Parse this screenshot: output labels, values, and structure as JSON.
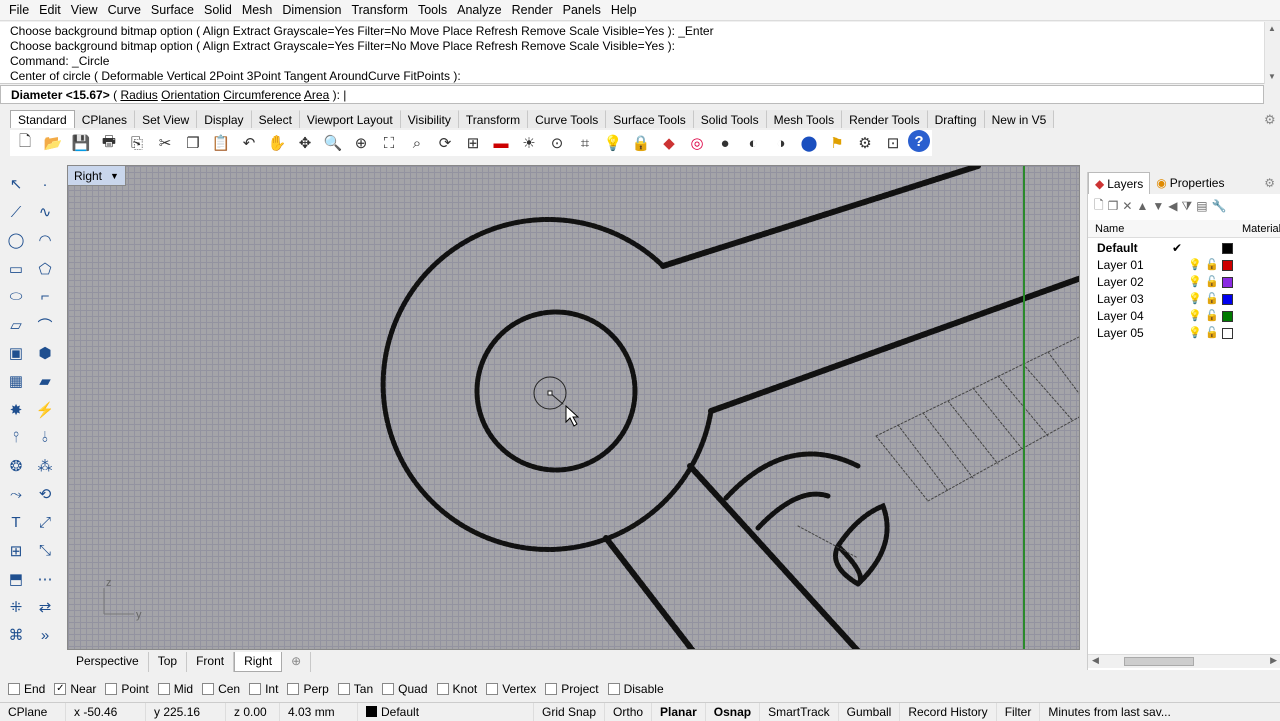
{
  "menu": [
    "File",
    "Edit",
    "View",
    "Curve",
    "Surface",
    "Solid",
    "Mesh",
    "Dimension",
    "Transform",
    "Tools",
    "Analyze",
    "Render",
    "Panels",
    "Help"
  ],
  "command_history": [
    "Choose background bitmap option ( Align  Extract  Grayscale=Yes  Filter=No  Move  Place  Refresh  Remove  Scale  Visible=Yes ): _Enter",
    "Choose background bitmap option ( Align  Extract  Grayscale=Yes  Filter=No  Move  Place  Refresh  Remove  Scale  Visible=Yes ):",
    "Command: _Circle",
    "Center of circle ( Deformable  Vertical  2Point  3Point  Tangent  AroundCurve  FitPoints ):"
  ],
  "command_prompt": {
    "label": "Diameter <15.67>",
    "options": [
      "Radius",
      "Orientation",
      "Circumference",
      "Area"
    ]
  },
  "toolbar_tabs": [
    "Standard",
    "CPlanes",
    "Set View",
    "Display",
    "Select",
    "Viewport Layout",
    "Visibility",
    "Transform",
    "Curve Tools",
    "Surface Tools",
    "Solid Tools",
    "Mesh Tools",
    "Render Tools",
    "Drafting",
    "New in V5"
  ],
  "toolbar_icons": [
    "new-icon",
    "open-icon",
    "save-icon",
    "print-icon",
    "import-icon",
    "cut-icon",
    "copy-icon",
    "paste-icon",
    "undo-icon",
    "pan-icon",
    "move-view-icon",
    "zoom-icon",
    "zoom-window-icon",
    "zoom-extents-icon",
    "zoom-selected-icon",
    "rotate-view-icon",
    "four-viewports-icon",
    "car-icon",
    "sun-icon",
    "point-osnap-icon",
    "grid-icon",
    "light-icon",
    "lock-icon",
    "layer-icon",
    "color-wheel-icon",
    "shade-icon",
    "sphere-icon",
    "render-sphere-icon",
    "material-icon",
    "flag-icon",
    "settings-icon",
    "options-icon",
    "help-icon"
  ],
  "viewport": {
    "title": "Right",
    "axis_z": "z",
    "axis_y": "y"
  },
  "viewport_tabs": [
    "Perspective",
    "Top",
    "Front",
    "Right"
  ],
  "osnap": [
    {
      "label": "End",
      "checked": false
    },
    {
      "label": "Near",
      "checked": true
    },
    {
      "label": "Point",
      "checked": false
    },
    {
      "label": "Mid",
      "checked": false
    },
    {
      "label": "Cen",
      "checked": false
    },
    {
      "label": "Int",
      "checked": false
    },
    {
      "label": "Perp",
      "checked": false
    },
    {
      "label": "Tan",
      "checked": false
    },
    {
      "label": "Quad",
      "checked": false
    },
    {
      "label": "Knot",
      "checked": false
    },
    {
      "label": "Vertex",
      "checked": false
    },
    {
      "label": "Project",
      "checked": false
    },
    {
      "label": "Disable",
      "checked": false
    }
  ],
  "status": {
    "cplane": "CPlane",
    "x": "x -50.46",
    "y": "y 225.16",
    "z": "z 0.00",
    "dist": "4.03 mm",
    "layer": "Default",
    "grid_snap": "Grid Snap",
    "ortho": "Ortho",
    "planar": "Planar",
    "osnap": "Osnap",
    "smarttrack": "SmartTrack",
    "gumball": "Gumball",
    "record_history": "Record History",
    "filter": "Filter",
    "minutes": "Minutes from last sav..."
  },
  "panel": {
    "tabs": [
      "Layers",
      "Properties"
    ],
    "col_name": "Name",
    "col_material": "Material",
    "layers": [
      {
        "name": "Default",
        "current": true,
        "color": "#000000"
      },
      {
        "name": "Layer 01",
        "current": false,
        "color": "#cc0000"
      },
      {
        "name": "Layer 02",
        "current": false,
        "color": "#8a2be2"
      },
      {
        "name": "Layer 03",
        "current": false,
        "color": "#0000ee"
      },
      {
        "name": "Layer 04",
        "current": false,
        "color": "#007a00"
      },
      {
        "name": "Layer 05",
        "current": false,
        "color": "#ffffff"
      }
    ]
  }
}
